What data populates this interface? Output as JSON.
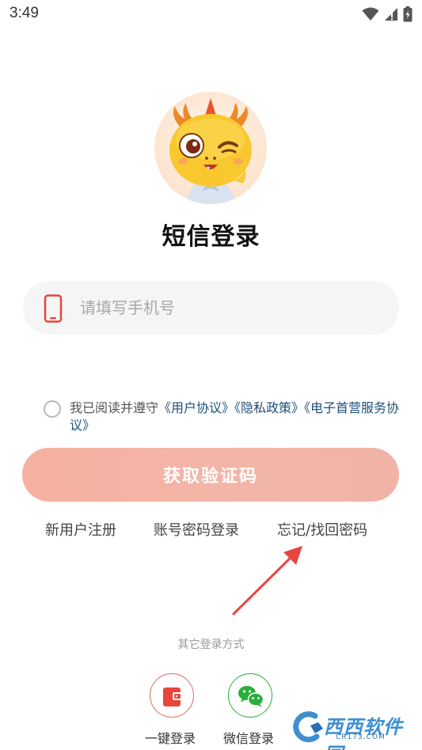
{
  "status_bar": {
    "time": "3:49",
    "icons": [
      "wifi-icon",
      "signal-icon",
      "battery-icon"
    ]
  },
  "avatar": {
    "icon": "dragon-mascot-icon"
  },
  "title": "短信登录",
  "phone_field": {
    "placeholder": "请填写手机号",
    "value": "",
    "icon": "mobile-phone-icon",
    "icon_color": "#e8453c"
  },
  "agreement": {
    "prefix": "我已阅读并遵守",
    "links": [
      "《用户协议》",
      "《隐私政策》",
      "《电子首营服务协议》"
    ],
    "checked": false
  },
  "get_code_button": {
    "label": "获取验证码",
    "color": "#f4b2a4"
  },
  "links": {
    "register": "新用户注册",
    "password_login": "账号密码登录",
    "forgot_password": "忘记/找回密码"
  },
  "other_login": {
    "label": "其它登录方式",
    "options": [
      {
        "label": "一键登录",
        "icon": "one-click-login-icon",
        "color": "#e8453c"
      },
      {
        "label": "微信登录",
        "icon": "wechat-icon",
        "color": "#2aae39"
      }
    ]
  },
  "watermark": {
    "text": "西西软件园",
    "sub": "CR173.COM"
  }
}
